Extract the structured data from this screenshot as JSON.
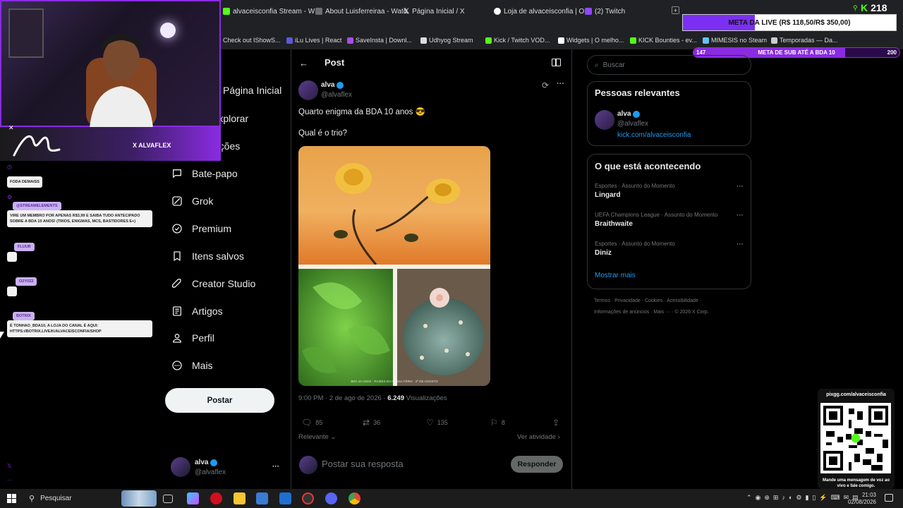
{
  "browser": {
    "tabs": [
      "alvaceisconfia Stream - W",
      "About Luisferreiraa - Watc",
      "Página Inicial / X",
      "Loja de alvaceisconfia | O",
      "(2) Twitch"
    ],
    "bookmarks": [
      "Check out IShowS...",
      "iLu Lives | React",
      "SaveInsta | Downl...",
      "Udhyog Stream",
      "Kick / Twitch VOD...",
      "Widgets | O melho...",
      "KICK Bounties - ev...",
      "MIMESIS no Steam",
      "Temporadas — Da..."
    ]
  },
  "overlay": {
    "viewer_count": "218",
    "goal_live": "META DA LIVE (R$ 118,50/R$ 350,00)",
    "goal_live_progress": 0.339,
    "sub_goal_label": "META DE SUB ATÉ A BDA 10",
    "sub_goal_current": "147",
    "sub_goal_target": "200",
    "sub_goal_progress": 0.735,
    "webcam_handle": "X ALVAFLEX",
    "chat": [
      {
        "badge": "",
        "text": "FODA DEMAISS"
      },
      {
        "badge": "@STREAMELEMENTS",
        "text": "VIRE UM MEMBRO POR APENAS R$3,99 E SAIBA TUDO ANTECIPADO SOBRE A BDA 10 ANOS! (TRIOS, ENIGMAS, MCS, BASTIDORES E+)"
      },
      {
        "badge": "FLUUR",
        "text": ""
      },
      {
        "badge": "O2Y0Z2",
        "text": ""
      },
      {
        "badge": "BOTRIX",
        "text": "É TONHAO_BDA10, A LOJA DO CANAL É AQUI: HTTPS://BOTRIX.LIVE/K/ALVACEISCONFIA/SHOP"
      }
    ],
    "qr_url": "pixgg.com/alvaceisconfia",
    "qr_caption": "Mande uma mensagem de voz ao vivo e fale comigo."
  },
  "nav": {
    "items": [
      "Página Inicial",
      "Explorar",
      "Notificações",
      "Bate-papo",
      "Grok",
      "Premium",
      "Itens salvos",
      "Creator Studio",
      "Artigos",
      "Perfil",
      "Mais"
    ],
    "post_button": "Postar",
    "account_name": "alva",
    "account_handle": "@alvaflex"
  },
  "post": {
    "header": "Post",
    "author_name": "alva",
    "author_handle": "@alvaflex",
    "text_line1": "Quarto enigma da BDA 10 anos 😎",
    "text_line2": "Qual é o trio?",
    "image_caption": "BDA 10 ANOS · RAÍZES DA NOSSA FÉRIA · 2º DE AGOSTO",
    "timestamp": "9:00 PM · 2 de ago de 2026 · ",
    "views": "6.249",
    "views_label": "Visualizações",
    "replies": "85",
    "reposts": "36",
    "likes": "135",
    "bookmarks": "8",
    "sort_label": "Relevante",
    "activity_label": "Ver atividade",
    "reply_placeholder": "Postar sua resposta",
    "reply_button": "Responder"
  },
  "sidebar": {
    "search_placeholder": "Buscar",
    "relevant_title": "Pessoas relevantes",
    "relevant_name": "alva",
    "relevant_handle": "@alvaflex",
    "relevant_link": "kick.com/alvaceisconfia",
    "trending_title": "O que está acontecendo",
    "trends": [
      {
        "category": "Esportes · Assunto do Momento",
        "name": "Lingard"
      },
      {
        "category": "UEFA Champions League · Assunto do Momento",
        "name": "Braithwaite"
      },
      {
        "category": "Esportes · Assunto do Momento",
        "name": "Diniz"
      }
    ],
    "show_more": "Mostrar mais",
    "footer_line1": "Termos · Privacidade · Cookies · Acessibilidade ·",
    "footer_line2": "Informações de anúncios · Mais ··· · © 2026 X Corp."
  },
  "taskbar": {
    "search": "Pesquisar",
    "date": "02/08/2026",
    "time": "21:03"
  },
  "colors": {
    "accent": "#1d9bf0",
    "kick_green": "#53fc18",
    "purple": "#8a2be2"
  }
}
